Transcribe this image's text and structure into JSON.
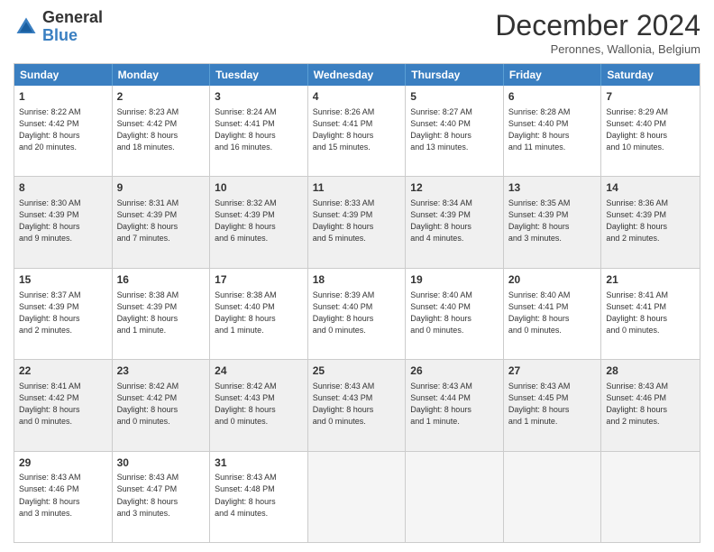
{
  "logo": {
    "text_general": "General",
    "text_blue": "Blue"
  },
  "header": {
    "month": "December 2024",
    "location": "Peronnes, Wallonia, Belgium"
  },
  "days": [
    "Sunday",
    "Monday",
    "Tuesday",
    "Wednesday",
    "Thursday",
    "Friday",
    "Saturday"
  ],
  "rows": [
    [
      {
        "day": "1",
        "lines": [
          "Sunrise: 8:22 AM",
          "Sunset: 4:42 PM",
          "Daylight: 8 hours",
          "and 20 minutes."
        ],
        "shade": false
      },
      {
        "day": "2",
        "lines": [
          "Sunrise: 8:23 AM",
          "Sunset: 4:42 PM",
          "Daylight: 8 hours",
          "and 18 minutes."
        ],
        "shade": false
      },
      {
        "day": "3",
        "lines": [
          "Sunrise: 8:24 AM",
          "Sunset: 4:41 PM",
          "Daylight: 8 hours",
          "and 16 minutes."
        ],
        "shade": false
      },
      {
        "day": "4",
        "lines": [
          "Sunrise: 8:26 AM",
          "Sunset: 4:41 PM",
          "Daylight: 8 hours",
          "and 15 minutes."
        ],
        "shade": false
      },
      {
        "day": "5",
        "lines": [
          "Sunrise: 8:27 AM",
          "Sunset: 4:40 PM",
          "Daylight: 8 hours",
          "and 13 minutes."
        ],
        "shade": false
      },
      {
        "day": "6",
        "lines": [
          "Sunrise: 8:28 AM",
          "Sunset: 4:40 PM",
          "Daylight: 8 hours",
          "and 11 minutes."
        ],
        "shade": false
      },
      {
        "day": "7",
        "lines": [
          "Sunrise: 8:29 AM",
          "Sunset: 4:40 PM",
          "Daylight: 8 hours",
          "and 10 minutes."
        ],
        "shade": false
      }
    ],
    [
      {
        "day": "8",
        "lines": [
          "Sunrise: 8:30 AM",
          "Sunset: 4:39 PM",
          "Daylight: 8 hours",
          "and 9 minutes."
        ],
        "shade": true
      },
      {
        "day": "9",
        "lines": [
          "Sunrise: 8:31 AM",
          "Sunset: 4:39 PM",
          "Daylight: 8 hours",
          "and 7 minutes."
        ],
        "shade": true
      },
      {
        "day": "10",
        "lines": [
          "Sunrise: 8:32 AM",
          "Sunset: 4:39 PM",
          "Daylight: 8 hours",
          "and 6 minutes."
        ],
        "shade": true
      },
      {
        "day": "11",
        "lines": [
          "Sunrise: 8:33 AM",
          "Sunset: 4:39 PM",
          "Daylight: 8 hours",
          "and 5 minutes."
        ],
        "shade": true
      },
      {
        "day": "12",
        "lines": [
          "Sunrise: 8:34 AM",
          "Sunset: 4:39 PM",
          "Daylight: 8 hours",
          "and 4 minutes."
        ],
        "shade": true
      },
      {
        "day": "13",
        "lines": [
          "Sunrise: 8:35 AM",
          "Sunset: 4:39 PM",
          "Daylight: 8 hours",
          "and 3 minutes."
        ],
        "shade": true
      },
      {
        "day": "14",
        "lines": [
          "Sunrise: 8:36 AM",
          "Sunset: 4:39 PM",
          "Daylight: 8 hours",
          "and 2 minutes."
        ],
        "shade": true
      }
    ],
    [
      {
        "day": "15",
        "lines": [
          "Sunrise: 8:37 AM",
          "Sunset: 4:39 PM",
          "Daylight: 8 hours",
          "and 2 minutes."
        ],
        "shade": false
      },
      {
        "day": "16",
        "lines": [
          "Sunrise: 8:38 AM",
          "Sunset: 4:39 PM",
          "Daylight: 8 hours",
          "and 1 minute."
        ],
        "shade": false
      },
      {
        "day": "17",
        "lines": [
          "Sunrise: 8:38 AM",
          "Sunset: 4:40 PM",
          "Daylight: 8 hours",
          "and 1 minute."
        ],
        "shade": false
      },
      {
        "day": "18",
        "lines": [
          "Sunrise: 8:39 AM",
          "Sunset: 4:40 PM",
          "Daylight: 8 hours",
          "and 0 minutes."
        ],
        "shade": false
      },
      {
        "day": "19",
        "lines": [
          "Sunrise: 8:40 AM",
          "Sunset: 4:40 PM",
          "Daylight: 8 hours",
          "and 0 minutes."
        ],
        "shade": false
      },
      {
        "day": "20",
        "lines": [
          "Sunrise: 8:40 AM",
          "Sunset: 4:41 PM",
          "Daylight: 8 hours",
          "and 0 minutes."
        ],
        "shade": false
      },
      {
        "day": "21",
        "lines": [
          "Sunrise: 8:41 AM",
          "Sunset: 4:41 PM",
          "Daylight: 8 hours",
          "and 0 minutes."
        ],
        "shade": false
      }
    ],
    [
      {
        "day": "22",
        "lines": [
          "Sunrise: 8:41 AM",
          "Sunset: 4:42 PM",
          "Daylight: 8 hours",
          "and 0 minutes."
        ],
        "shade": true
      },
      {
        "day": "23",
        "lines": [
          "Sunrise: 8:42 AM",
          "Sunset: 4:42 PM",
          "Daylight: 8 hours",
          "and 0 minutes."
        ],
        "shade": true
      },
      {
        "day": "24",
        "lines": [
          "Sunrise: 8:42 AM",
          "Sunset: 4:43 PM",
          "Daylight: 8 hours",
          "and 0 minutes."
        ],
        "shade": true
      },
      {
        "day": "25",
        "lines": [
          "Sunrise: 8:43 AM",
          "Sunset: 4:43 PM",
          "Daylight: 8 hours",
          "and 0 minutes."
        ],
        "shade": true
      },
      {
        "day": "26",
        "lines": [
          "Sunrise: 8:43 AM",
          "Sunset: 4:44 PM",
          "Daylight: 8 hours",
          "and 1 minute."
        ],
        "shade": true
      },
      {
        "day": "27",
        "lines": [
          "Sunrise: 8:43 AM",
          "Sunset: 4:45 PM",
          "Daylight: 8 hours",
          "and 1 minute."
        ],
        "shade": true
      },
      {
        "day": "28",
        "lines": [
          "Sunrise: 8:43 AM",
          "Sunset: 4:46 PM",
          "Daylight: 8 hours",
          "and 2 minutes."
        ],
        "shade": true
      }
    ],
    [
      {
        "day": "29",
        "lines": [
          "Sunrise: 8:43 AM",
          "Sunset: 4:46 PM",
          "Daylight: 8 hours",
          "and 3 minutes."
        ],
        "shade": false
      },
      {
        "day": "30",
        "lines": [
          "Sunrise: 8:43 AM",
          "Sunset: 4:47 PM",
          "Daylight: 8 hours",
          "and 3 minutes."
        ],
        "shade": false
      },
      {
        "day": "31",
        "lines": [
          "Sunrise: 8:43 AM",
          "Sunset: 4:48 PM",
          "Daylight: 8 hours",
          "and 4 minutes."
        ],
        "shade": false
      },
      {
        "day": "",
        "lines": [],
        "shade": false,
        "empty": true
      },
      {
        "day": "",
        "lines": [],
        "shade": false,
        "empty": true
      },
      {
        "day": "",
        "lines": [],
        "shade": false,
        "empty": true
      },
      {
        "day": "",
        "lines": [],
        "shade": false,
        "empty": true
      }
    ]
  ]
}
